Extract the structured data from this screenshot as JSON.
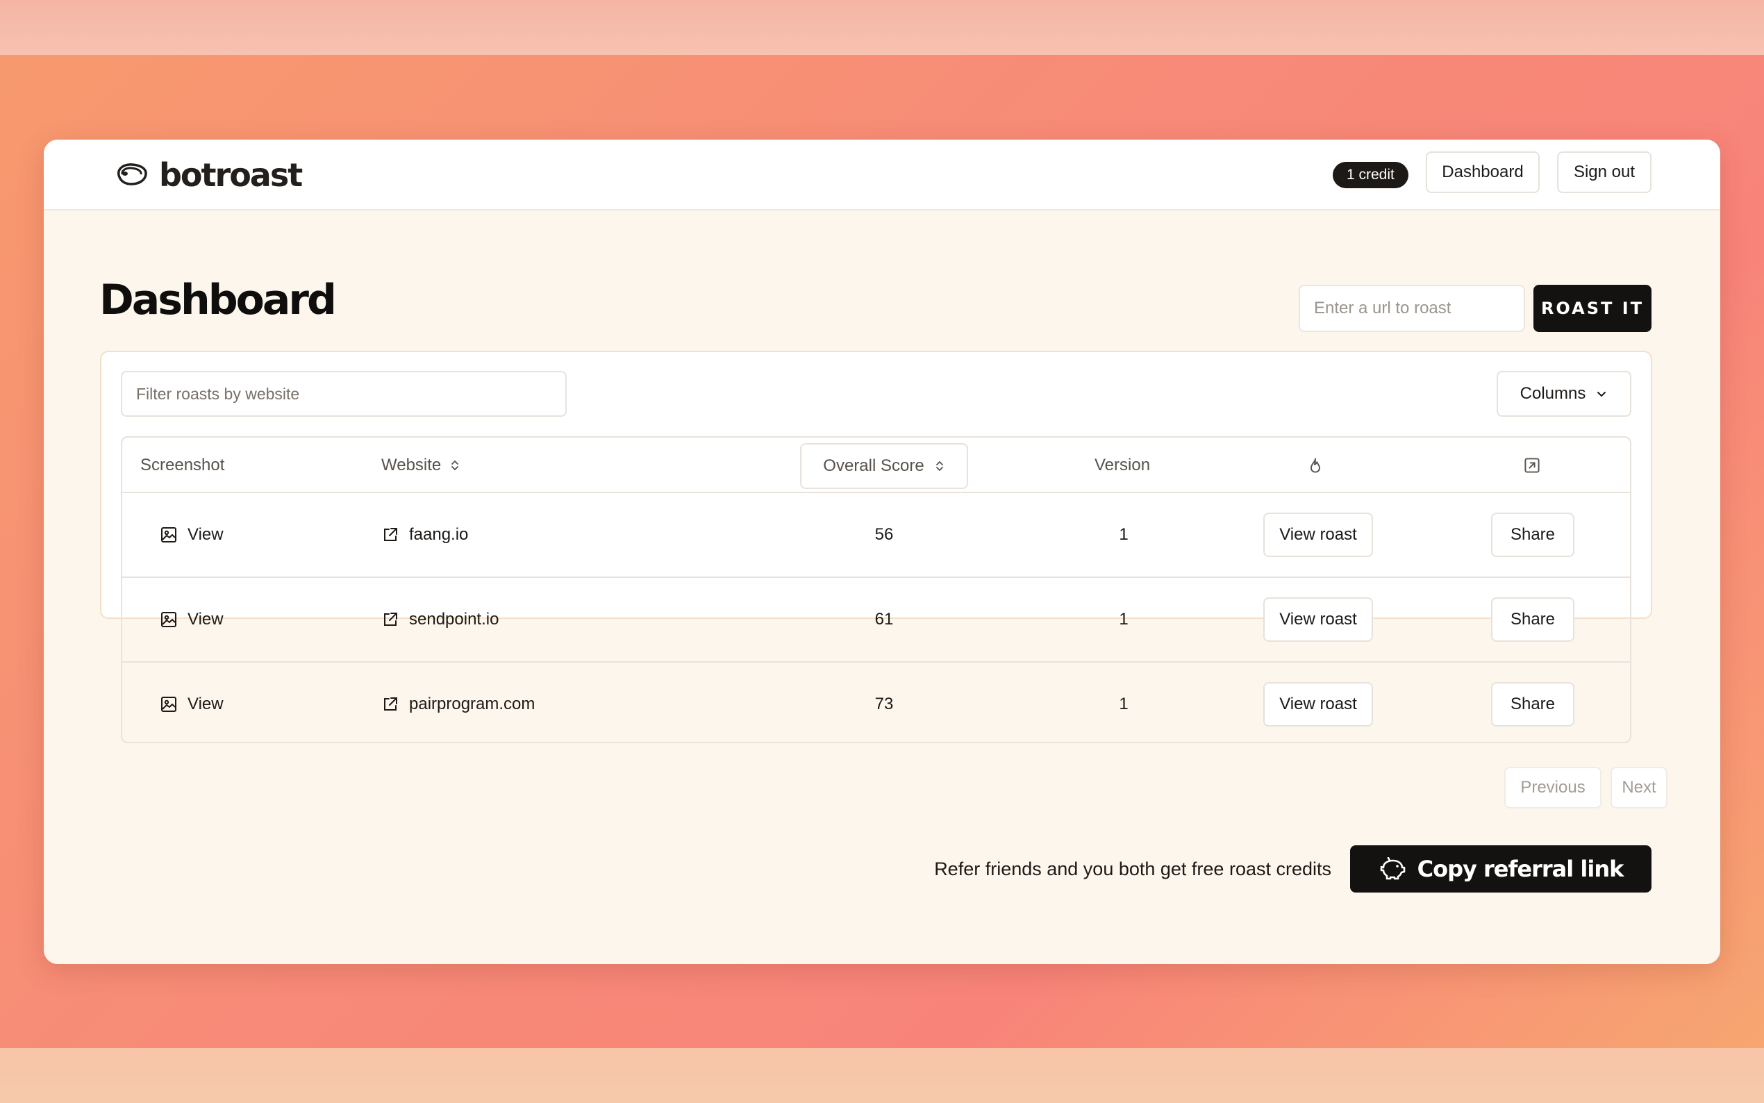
{
  "brand": {
    "name": "botroast"
  },
  "header": {
    "credits": "1 credit",
    "dashboard_label": "Dashboard",
    "signout_label": "Sign out"
  },
  "page": {
    "title": "Dashboard",
    "url_placeholder": "Enter a url to roast",
    "roast_label": "ROAST IT"
  },
  "table": {
    "filter_placeholder": "Filter roasts by website",
    "columns_label": "Columns",
    "headers": {
      "screenshot": "Screenshot",
      "website": "Website",
      "score": "Overall Score",
      "version": "Version"
    },
    "rows": [
      {
        "screenshot_label": "View",
        "website": "faang.io",
        "score": "56",
        "version": "1",
        "view_label": "View roast",
        "share_label": "Share"
      },
      {
        "screenshot_label": "View",
        "website": "sendpoint.io",
        "score": "61",
        "version": "1",
        "view_label": "View roast",
        "share_label": "Share"
      },
      {
        "screenshot_label": "View",
        "website": "pairprogram.com",
        "score": "73",
        "version": "1",
        "view_label": "View roast",
        "share_label": "Share"
      }
    ],
    "pagination": {
      "previous": "Previous",
      "next": "Next"
    }
  },
  "referral": {
    "text": "Refer friends and you both get free roast credits",
    "button_label": "Copy referral link"
  },
  "icons": {
    "logo": "steak-icon",
    "image": "image-icon",
    "external": "external-link-icon",
    "sort": "sort-icon",
    "flame": "flame-icon",
    "share": "share-square-icon",
    "chevron": "chevron-down-icon",
    "piggy": "piggy-bank-icon"
  },
  "colors": {
    "accent_dark": "#141211",
    "window_bg": "#fdf6ec",
    "card_border": "#f4dfc8"
  }
}
